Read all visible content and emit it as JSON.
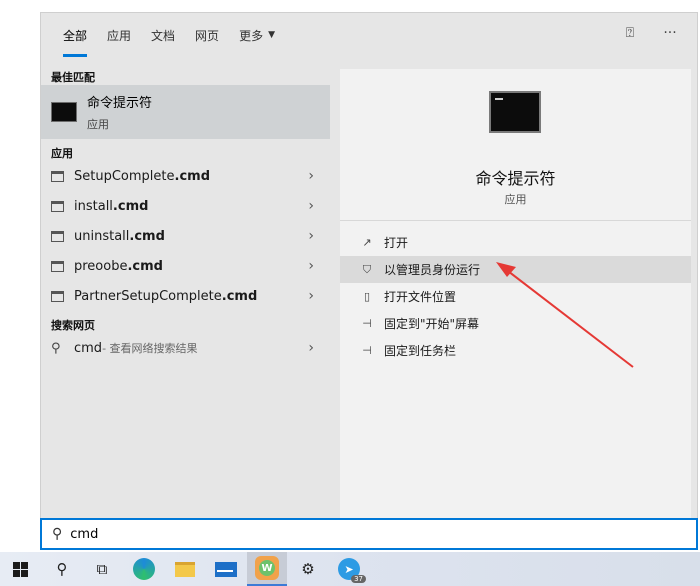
{
  "tabs": [
    "全部",
    "应用",
    "文档",
    "网页",
    "更多"
  ],
  "best_match": {
    "section": "最佳匹配",
    "title": "命令提示符",
    "subtitle": "应用"
  },
  "apps": {
    "section": "应用",
    "items": [
      {
        "prefix": "SetupComplete",
        "suffix": ".cmd"
      },
      {
        "prefix": "install",
        "suffix": ".cmd"
      },
      {
        "prefix": "uninstall",
        "suffix": ".cmd"
      },
      {
        "prefix": "preoobe",
        "suffix": ".cmd"
      },
      {
        "prefix": "PartnerSetupComplete",
        "suffix": ".cmd"
      }
    ]
  },
  "web": {
    "section": "搜索网页",
    "query": "cmd",
    "hint": " - 查看网络搜索结果"
  },
  "detail": {
    "title": "命令提示符",
    "subtitle": "应用",
    "actions": [
      "打开",
      "以管理员身份运行",
      "打开文件位置",
      "固定到\"开始\"屏幕",
      "固定到任务栏"
    ]
  },
  "search": {
    "value": "cmd"
  },
  "taskbar": {
    "badge": "37"
  },
  "colors": {
    "accent": "#0078d7",
    "highlight": "#cfd2d4",
    "arrow": "#e53935"
  }
}
